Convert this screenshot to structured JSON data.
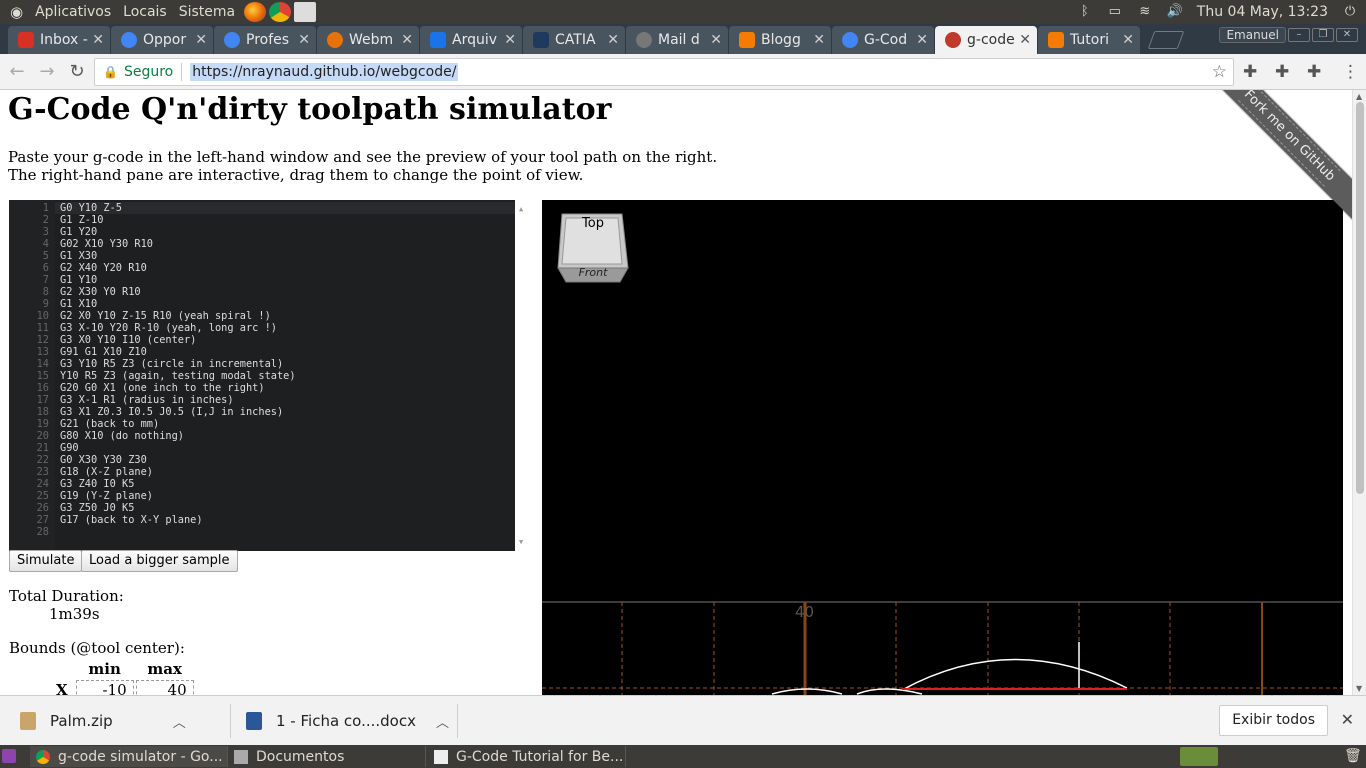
{
  "panel": {
    "menus": [
      "Aplicativos",
      "Locais",
      "Sistema"
    ],
    "clock": "Thu 04 May, 13:23"
  },
  "tabs": [
    {
      "label": "Inbox -",
      "color": "#d93025"
    },
    {
      "label": "Oppor",
      "color": "#4285f4"
    },
    {
      "label": "Profes",
      "color": "#4285f4"
    },
    {
      "label": "Webm",
      "color": "#e8710a"
    },
    {
      "label": "Arquiv",
      "color": "#1a73e8"
    },
    {
      "label": "CATIA",
      "color": "#1e3a5f"
    },
    {
      "label": "Mail d",
      "color": "#777777"
    },
    {
      "label": "Blogg",
      "color": "#f57c00"
    },
    {
      "label": "G-Cod",
      "color": "#4285f4"
    },
    {
      "label": "g-code",
      "color": "#c0392b"
    },
    {
      "label": "Tutori",
      "color": "#f57c00"
    }
  ],
  "profile": "Emanuel",
  "address": {
    "secure_label": "Seguro",
    "url": "https://nraynaud.github.io/webgcode/"
  },
  "page": {
    "title": "G-Code Q'n'dirty toolpath simulator",
    "intro_line1": "Paste your g-code in the left-hand window and see the preview of your tool path on the right.",
    "intro_line2": "The right-hand pane are interactive, drag them to change the point of view.",
    "code_lines": [
      "G0 Y10 Z-5",
      "G1 Z-10",
      "G1 Y20",
      "G02 X10 Y30 R10",
      "G1 X30",
      "G2 X40 Y20 R10",
      "G1 Y10",
      "G2 X30 Y0 R10",
      "G1 X10",
      "G2 X0 Y10 Z-15 R10 (yeah spiral !)",
      "G3 X-10 Y20 R-10 (yeah, long arc !)",
      "G3 X0 Y10 I10 (center)",
      "G91 G1 X10 Z10",
      "G3 Y10 R5 Z3 (circle in incremental)",
      "Y10 R5 Z3 (again, testing modal state)",
      "G20 G0 X1 (one inch to the right)",
      "G3 X-1 R1 (radius in inches)",
      "G3 X1 Z0.3 I0.5 J0.5 (I,J in inches)",
      "G21 (back to mm)",
      "G80 X10 (do nothing)",
      "G90",
      "G0 X30 Y30 Z30",
      "G18 (X-Z plane)",
      "G3 Z40 I0 K5",
      "G19 (Y-Z plane)",
      "G3 Z50 J0 K5",
      "G17 (back to X-Y plane)",
      ""
    ],
    "simulate_label": "Simulate",
    "load_label": "Load a bigger sample",
    "duration_label": "Total Duration:",
    "duration_value": "1m39s",
    "bounds_label": "Bounds (@tool center):",
    "bounds_min_header": "min",
    "bounds_max_header": "max",
    "bounds_axis": "X",
    "bounds_min": "-10",
    "bounds_max": "40",
    "viewcube_top": "Top",
    "viewcube_front": "Front",
    "grid_label": "40",
    "ribbon": "Fork me on GitHub"
  },
  "downloads": [
    {
      "name": "Palm.zip"
    },
    {
      "name": "1 - Ficha co....docx"
    }
  ],
  "downloads_show_all": "Exibir todos",
  "taskbar": [
    {
      "label": "g-code simulator - Go..."
    },
    {
      "label": "Documentos"
    },
    {
      "label": "G-Code Tutorial for Be..."
    }
  ]
}
